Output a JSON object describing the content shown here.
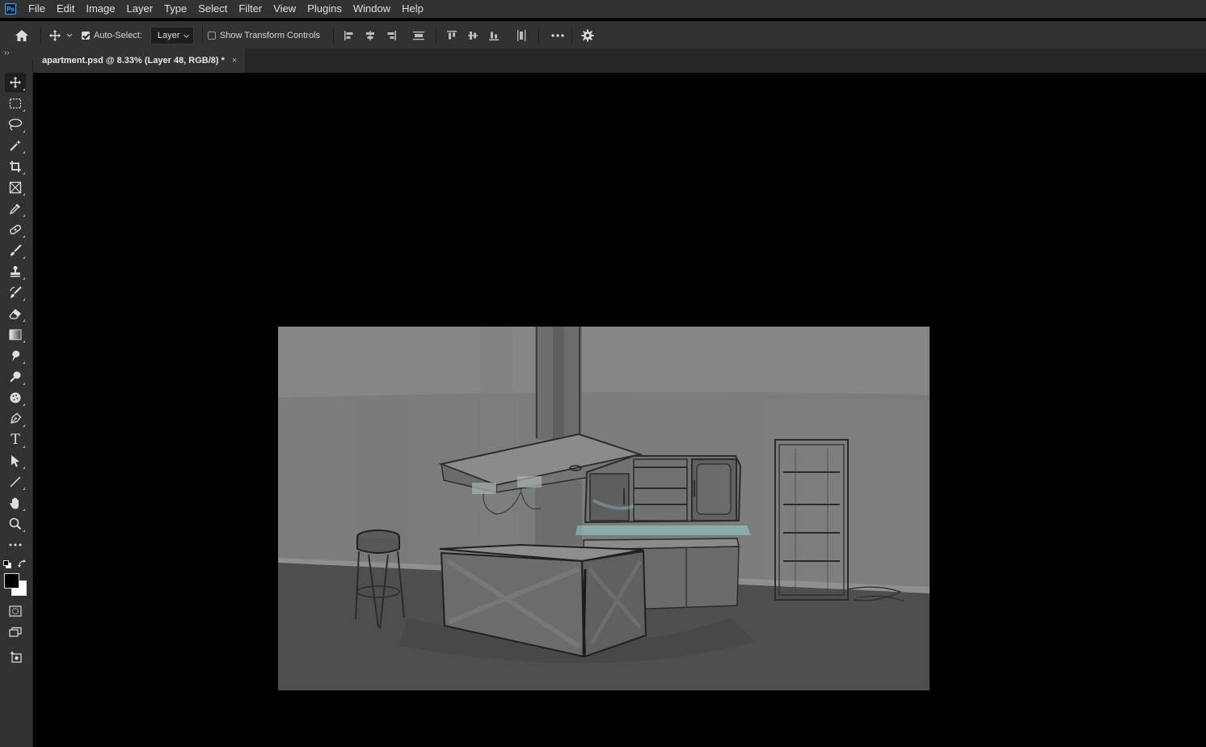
{
  "app": {
    "logo_text": "Ps"
  },
  "menu": [
    "File",
    "Edit",
    "Image",
    "Layer",
    "Type",
    "Select",
    "Filter",
    "View",
    "Plugins",
    "Window",
    "Help"
  ],
  "options": {
    "auto_select_label": "Auto-Select:",
    "auto_select_checked": true,
    "layer_dropdown_value": "Layer",
    "show_transform_label": "Show Transform Controls",
    "show_transform_checked": false
  },
  "panel_toggle": "››",
  "tab": {
    "title": "apartment.psd @ 8.33% (Layer 48, RGB/8) *",
    "close": "×"
  },
  "tools": [
    {
      "name": "move-tool",
      "icon": "move-icon"
    },
    {
      "name": "rectangular-marquee-tool",
      "icon": "marquee-icon"
    },
    {
      "name": "lasso-tool",
      "icon": "lasso-icon"
    },
    {
      "name": "magic-wand-tool",
      "icon": "magic-wand-icon"
    },
    {
      "name": "crop-tool",
      "icon": "crop-icon"
    },
    {
      "name": "frame-tool",
      "icon": "frame-icon"
    },
    {
      "name": "eyedropper-tool",
      "icon": "eyedropper-icon"
    },
    {
      "name": "healing-brush-tool",
      "icon": "bandage-icon"
    },
    {
      "name": "brush-tool",
      "icon": "brush-icon"
    },
    {
      "name": "clone-stamp-tool",
      "icon": "stamp-icon"
    },
    {
      "name": "history-brush-tool",
      "icon": "history-brush-icon"
    },
    {
      "name": "eraser-tool",
      "icon": "eraser-icon"
    },
    {
      "name": "gradient-tool",
      "icon": "gradient-icon"
    },
    {
      "name": "smudge-tool",
      "icon": "smudge-icon"
    },
    {
      "name": "dodge-tool",
      "icon": "dodge-icon"
    },
    {
      "name": "sponge-tool",
      "icon": "sponge-icon"
    },
    {
      "name": "pen-tool",
      "icon": "pen-icon"
    },
    {
      "name": "type-tool",
      "icon": "type-icon"
    },
    {
      "name": "path-selection-tool",
      "icon": "arrow-icon"
    },
    {
      "name": "line-tool",
      "icon": "line-icon"
    },
    {
      "name": "hand-tool",
      "icon": "hand-icon"
    },
    {
      "name": "zoom-tool",
      "icon": "zoom-icon"
    },
    {
      "name": "edit-toolbar",
      "icon": "more-icon"
    }
  ],
  "type_tool_glyph": "T",
  "colors": {
    "foreground": "#000000",
    "background": "#ffffff",
    "ui_panel": "#323232",
    "ui_dark": "#262626",
    "accent_cyan": "#9fe3e8"
  }
}
